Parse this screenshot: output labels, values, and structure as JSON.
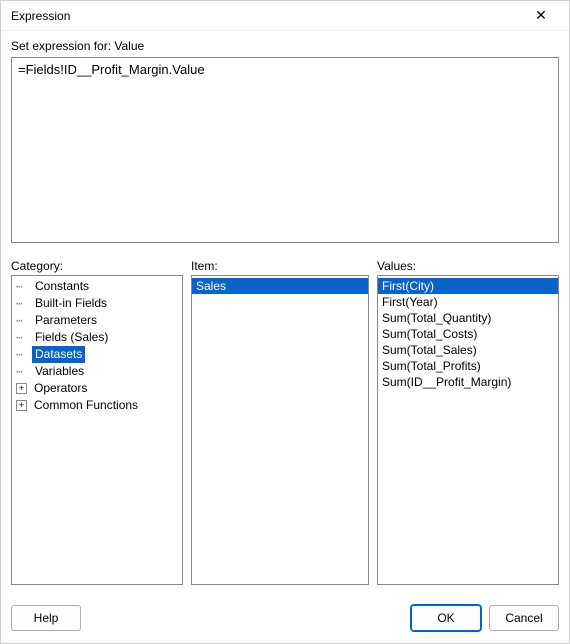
{
  "titlebar": {
    "title": "Expression",
    "close_icon": "✕"
  },
  "set_label": "Set expression for: Value",
  "expression_value": "=Fields!ID__Profit_Margin.Value",
  "labels": {
    "category": "Category:",
    "item": "Item:",
    "values": "Values:"
  },
  "category_tree": [
    {
      "label": "Constants",
      "expandable": false,
      "selected": false
    },
    {
      "label": "Built-in Fields",
      "expandable": false,
      "selected": false
    },
    {
      "label": "Parameters",
      "expandable": false,
      "selected": false
    },
    {
      "label": "Fields (Sales)",
      "expandable": false,
      "selected": false
    },
    {
      "label": "Datasets",
      "expandable": false,
      "selected": true
    },
    {
      "label": "Variables",
      "expandable": false,
      "selected": false
    },
    {
      "label": "Operators",
      "expandable": true,
      "selected": false
    },
    {
      "label": "Common Functions",
      "expandable": true,
      "selected": false
    }
  ],
  "item_list": [
    {
      "label": "Sales",
      "selected": true
    }
  ],
  "values_list": [
    {
      "label": "First(City)",
      "selected": true
    },
    {
      "label": "First(Year)",
      "selected": false
    },
    {
      "label": "Sum(Total_Quantity)",
      "selected": false
    },
    {
      "label": "Sum(Total_Costs)",
      "selected": false
    },
    {
      "label": "Sum(Total_Sales)",
      "selected": false
    },
    {
      "label": "Sum(Total_Profits)",
      "selected": false
    },
    {
      "label": "Sum(ID__Profit_Margin)",
      "selected": false
    }
  ],
  "footer": {
    "help": "Help",
    "ok": "OK",
    "cancel": "Cancel"
  },
  "glyphs": {
    "plus": "+"
  }
}
